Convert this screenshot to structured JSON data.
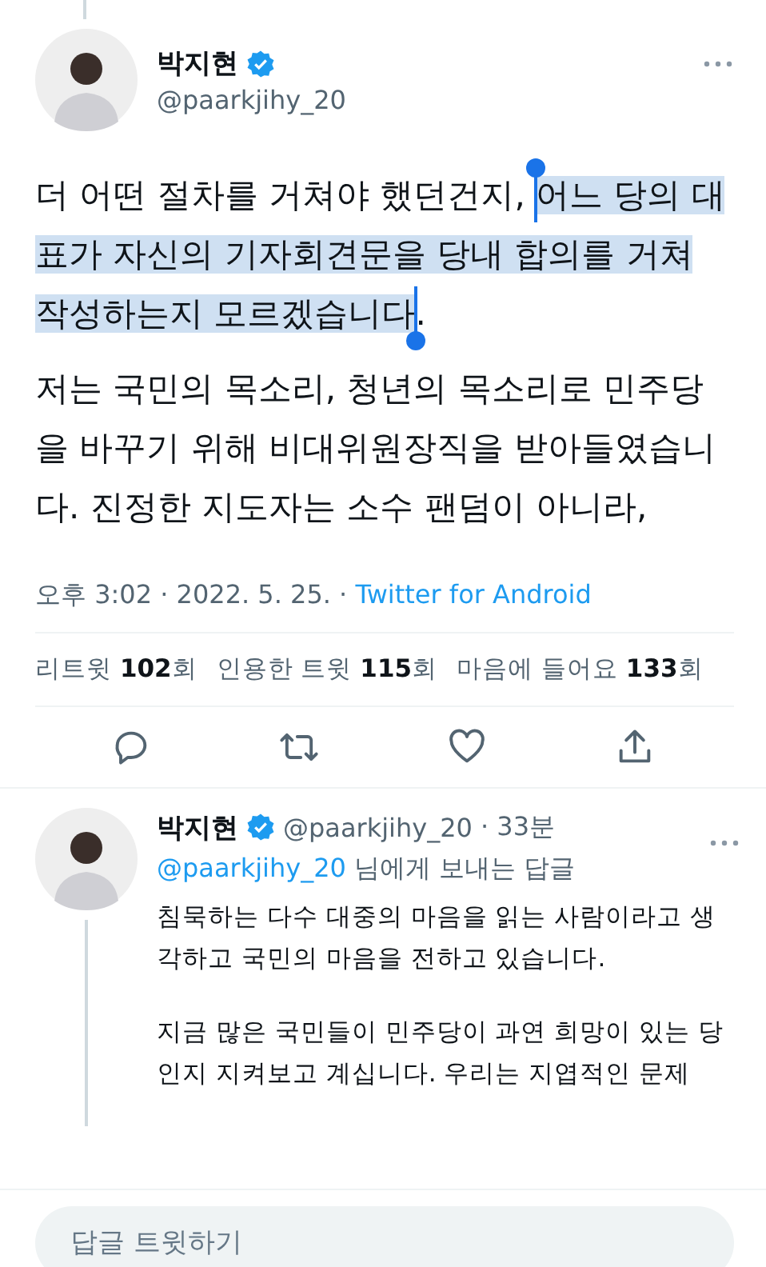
{
  "tweet": {
    "author": {
      "name": "박지현",
      "verified": true,
      "handle": "@paarkjihy_20"
    },
    "paragraphs": [
      {
        "segments": [
          {
            "text": "더 어떤 절차를 거쳐야 했던건지, ",
            "selected": false
          },
          {
            "text": "어느 당의 대표가 자신의 기자회견문을 당내 합의를 거쳐 작성하는지 모르겠습니다",
            "selected": true
          },
          {
            "text": ".",
            "selected": false
          }
        ]
      },
      {
        "segments": [
          {
            "text": "저는 국민의 목소리, 청년의 목소리로 민주당을 바꾸기 위해 비대위원장직을 받아들였습니다. 진정한 지도자는 소수 팬덤이 아니라,",
            "selected": false
          }
        ]
      }
    ],
    "time": "오후 3:02 · 2022. 5. 25. · ",
    "source": "Twitter for Android",
    "stats": [
      {
        "label": "리트윗",
        "count": "102",
        "unit": "회"
      },
      {
        "label": "인용한 트윗",
        "count": "115",
        "unit": "회"
      },
      {
        "label": "마음에 들어요",
        "count": "133",
        "unit": "회"
      }
    ],
    "actions": [
      {
        "kind": "reply"
      },
      {
        "kind": "retweet"
      },
      {
        "kind": "like"
      },
      {
        "kind": "share"
      }
    ]
  },
  "reply": {
    "author": {
      "name": "박지현",
      "verified": true,
      "handle": "@paarkjihy_20"
    },
    "age": "· 33분",
    "reply_to": "@paarkjihy_20",
    "reply_to_suffix": " 님에게 보내는 답글",
    "paragraphs": [
      "침묵하는 다수 대중의 마음을 읽는 사람이라고 생각하고 국민의 마음을 전하고 있습니다.",
      "지금 많은 국민들이 민주당이 과연 희망이 있는 당인지 지켜보고 계십니다. 우리는 지엽적인 문제"
    ]
  },
  "reply_bar": {
    "placeholder": "답글 트윗하기"
  }
}
